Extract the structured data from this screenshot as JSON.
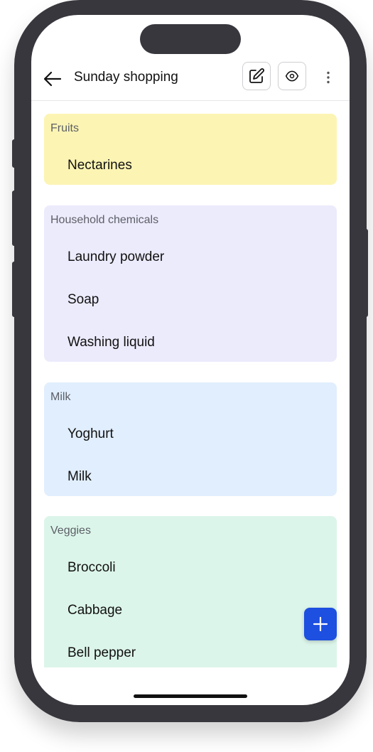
{
  "header": {
    "title": "Sunday shopping",
    "back_icon": "arrow-left-icon",
    "edit_icon": "pencil-square-icon",
    "view_icon": "eye-icon",
    "more_icon": "kebab-menu-icon"
  },
  "groups": [
    {
      "name": "Fruits",
      "color": "#fcf4b3",
      "items": [
        "Nectarines"
      ]
    },
    {
      "name": "Household chemicals",
      "color": "#ecebfc",
      "items": [
        "Laundry powder",
        "Soap",
        "Washing liquid"
      ]
    },
    {
      "name": "Milk",
      "color": "#e1eefd",
      "items": [
        "Yoghurt",
        "Milk"
      ]
    },
    {
      "name": "Veggies",
      "color": "#dcf5ea",
      "items": [
        "Broccoli",
        "Cabbage",
        "Bell pepper"
      ]
    }
  ],
  "fab": {
    "icon": "plus-icon",
    "color": "#1d4fe0"
  }
}
